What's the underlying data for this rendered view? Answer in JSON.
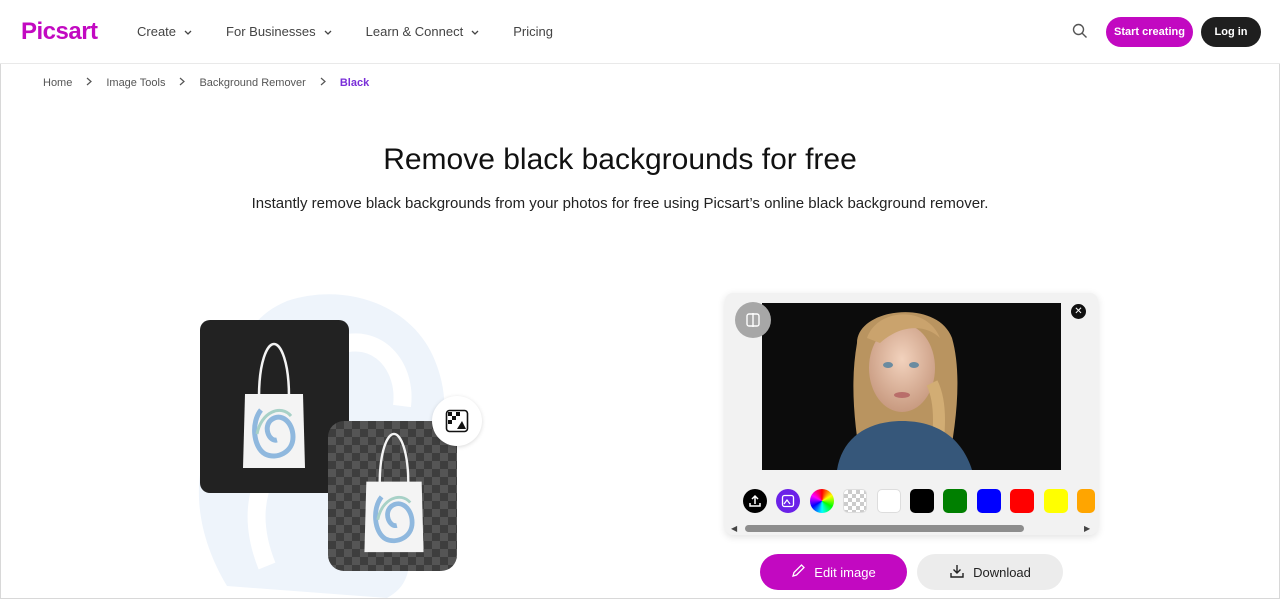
{
  "brand": {
    "logo_text": "Picsart",
    "accent": "#c209c1"
  },
  "nav": {
    "items": [
      {
        "label": "Create",
        "has_dropdown": true
      },
      {
        "label": "For Businesses",
        "has_dropdown": true
      },
      {
        "label": "Learn & Connect",
        "has_dropdown": true
      },
      {
        "label": "Pricing",
        "has_dropdown": false
      }
    ],
    "search_icon": "search-icon",
    "start_label": "Start creating",
    "login_label": "Log in"
  },
  "breadcrumb": {
    "items": [
      "Home",
      "Image Tools",
      "Background Remover",
      "Black"
    ]
  },
  "hero": {
    "title": "Remove black backgrounds for free",
    "subtitle": "Instantly remove black backgrounds from your photos for free using Picsart’s online black background remover."
  },
  "editor": {
    "swatches": [
      {
        "name": "upload",
        "color": "#000000"
      },
      {
        "name": "ai-background",
        "color": "#6b21e8"
      },
      {
        "name": "color-wheel",
        "color": ""
      },
      {
        "name": "transparent",
        "color": ""
      },
      {
        "name": "white",
        "color": "#ffffff"
      },
      {
        "name": "black",
        "color": "#000000"
      },
      {
        "name": "green",
        "color": "#007f00"
      },
      {
        "name": "blue",
        "color": "#0000ff"
      },
      {
        "name": "red",
        "color": "#ff0000"
      },
      {
        "name": "yellow",
        "color": "#ffff00"
      },
      {
        "name": "orange",
        "color": "#ffa500"
      }
    ],
    "edit_label": "Edit image",
    "download_label": "Download"
  }
}
